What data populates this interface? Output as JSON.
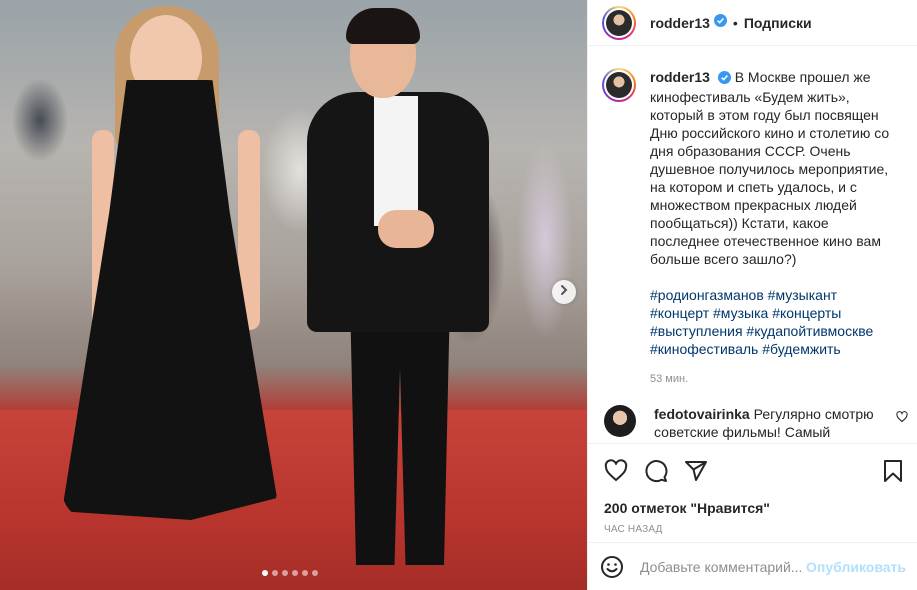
{
  "post": {
    "slide_count": 6,
    "active_slide": 1
  },
  "header": {
    "username": "rodder13",
    "separator": "•",
    "follow_label": "Подписки"
  },
  "caption": {
    "username": "rodder13",
    "text": "В Москве прошел же кинофестиваль «Будем жить», который в этом году был посвящен Дню российского кино и столетию со дня образования СССР. Очень душевное получилось мероприятие, на котором и спеть удалось, и с множеством прекрасных людей пообщаться)) Кстати, какое последнее отечественное кино вам больше всего зашло?)",
    "tags_line1": [
      "#родионгазманов",
      "#музыкант"
    ],
    "tags_line2": [
      "#концерт",
      "#музыка",
      "#концерты"
    ],
    "tags_line3": [
      "#выступления",
      "#кудапойтивмоскве"
    ],
    "tags_line4": [
      "#кинофестиваль",
      "#будемжить"
    ],
    "time": "53 мин."
  },
  "comment": {
    "username": "fedotovairinka",
    "text": "Регулярно смотрю советские фильмы! Самый"
  },
  "actions": {
    "likes": "200 отметок \"Нравится\"",
    "ago": "ЧАС НАЗАД"
  },
  "add_comment": {
    "placeholder": "Добавьте комментарий...",
    "publish_label": "Опубликовать"
  },
  "colors": {
    "verified": "#3897f0",
    "link": "#00376b",
    "publish_disabled": "#b2dffc"
  },
  "icons": [
    "verified-icon",
    "chevron-right-icon",
    "heart-icon",
    "comment-icon",
    "share-icon",
    "bookmark-icon",
    "emoji-icon"
  ]
}
